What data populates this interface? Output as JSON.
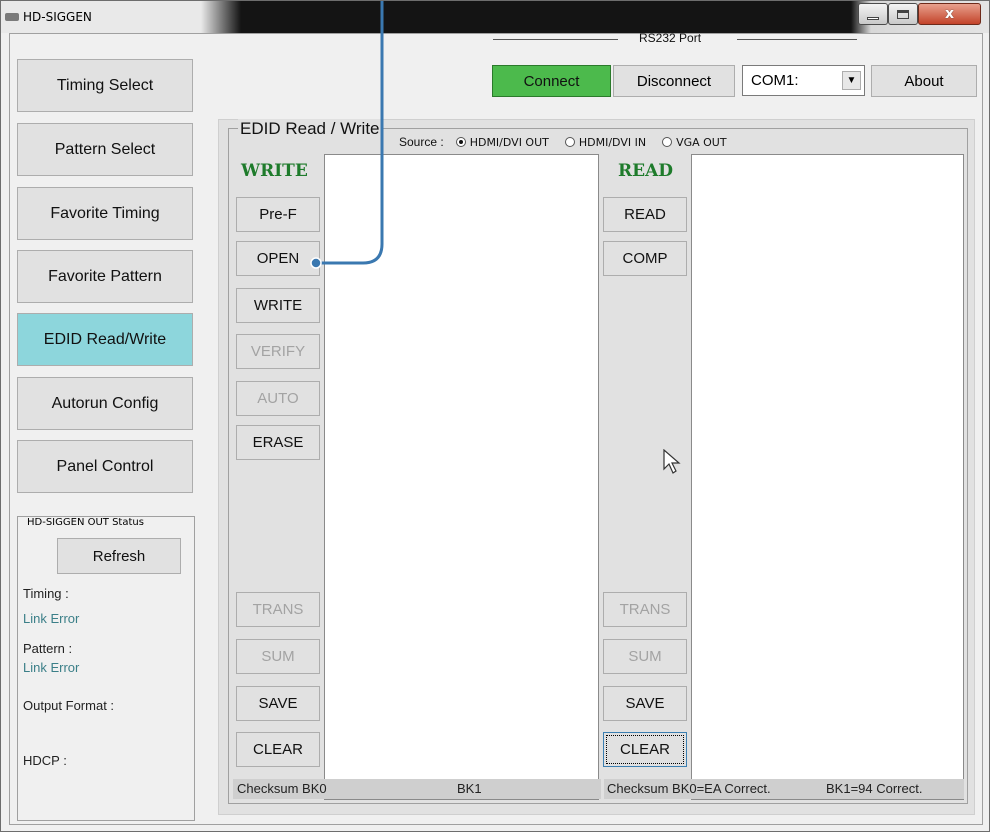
{
  "window": {
    "title": "HD-SIGGEN",
    "controls": {
      "minimize_icon": "minimize-icon",
      "maximize_icon": "maximize-icon",
      "close_icon": "close-icon",
      "close_glyph": "x"
    }
  },
  "nav": {
    "items": [
      {
        "label": "Timing Select",
        "active": false
      },
      {
        "label": "Pattern Select",
        "active": false
      },
      {
        "label": "Favorite Timing",
        "active": false
      },
      {
        "label": "Favorite Pattern",
        "active": false
      },
      {
        "label": "EDID Read/Write",
        "active": true
      },
      {
        "label": "Autorun Config",
        "active": false
      },
      {
        "label": "Panel Control",
        "active": false
      }
    ]
  },
  "status": {
    "legend": "HD-SIGGEN OUT Status",
    "refresh_label": "Refresh",
    "timing_label": "Timing :",
    "timing_value": "Link Error",
    "pattern_label": "Pattern :",
    "pattern_value": "Link Error",
    "output_format_label": "Output Format :",
    "hdcp_label": "HDCP :"
  },
  "rs232": {
    "label": "RS232 Port",
    "connect_label": "Connect",
    "disconnect_label": "Disconnect",
    "com_value": "COM1:",
    "about_label": "About"
  },
  "edid": {
    "legend": "EDID Read / Write",
    "source_label": "Source :",
    "sources": [
      {
        "label": "HDMI/DVI OUT",
        "selected": true
      },
      {
        "label": "HDMI/DVI IN",
        "selected": false
      },
      {
        "label": "VGA OUT",
        "selected": false
      }
    ],
    "write": {
      "heading": "WRITE",
      "buttons": {
        "pref": "Pre-F",
        "open": "OPEN",
        "write": "WRITE",
        "verify": "VERIFY",
        "auto": "AUTO",
        "erase": "ERASE",
        "trans": "TRANS",
        "sum": "SUM",
        "save": "SAVE",
        "clear": "CLEAR"
      },
      "checksum_bk0": "Checksum BK0",
      "checksum_bk1": "BK1"
    },
    "read": {
      "heading": "READ",
      "buttons": {
        "read": "READ",
        "comp": "COMP",
        "trans": "TRANS",
        "sum": "SUM",
        "save": "SAVE",
        "clear": "CLEAR"
      },
      "checksum_bk0": "Checksum BK0=EA Correct.",
      "checksum_bk1": "BK1=94 Correct."
    }
  },
  "colors": {
    "active_nav": "#8dd6dc",
    "connect": "#4cba4c",
    "heading_green": "#1e7b2b",
    "status_value": "#3b7f88",
    "annotation": "#3a78b0"
  }
}
